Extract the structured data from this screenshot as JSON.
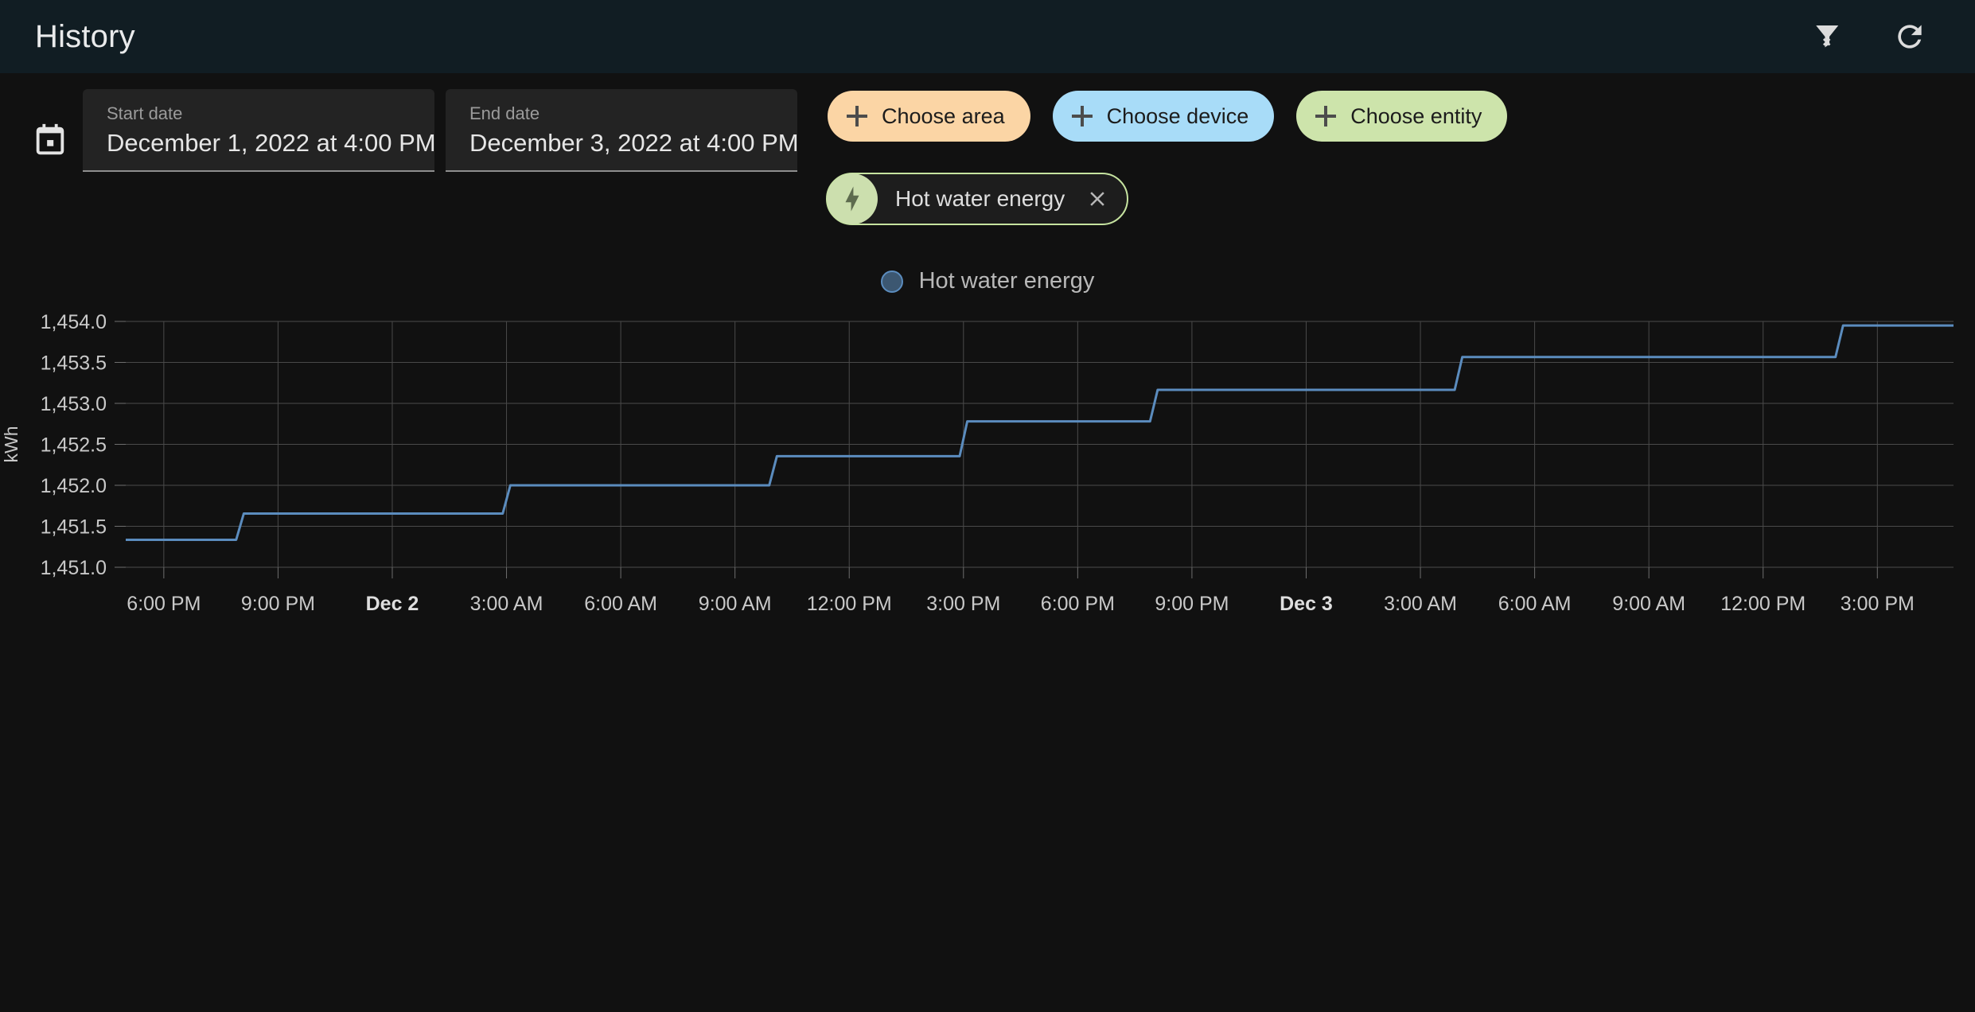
{
  "appbar": {
    "title": "History",
    "actions": [
      {
        "name": "filter-remove-icon",
        "label": "Clear filters"
      },
      {
        "name": "refresh-icon",
        "label": "Refresh"
      }
    ]
  },
  "filters": {
    "calendar_icon": "calendar-icon",
    "start_date": {
      "label": "Start date",
      "value": "December 1, 2022 at 4:00 PM"
    },
    "end_date": {
      "label": "End date",
      "value": "December 3, 2022 at 4:00 PM"
    },
    "choosers": [
      {
        "label": "Choose area",
        "color": "#fbd5a5",
        "icon": "plus-icon"
      },
      {
        "label": "Choose device",
        "color": "#a8dcf8",
        "icon": "plus-icon"
      },
      {
        "label": "Choose entity",
        "color": "#cde4ab",
        "icon": "plus-icon"
      }
    ],
    "selected_entities": [
      {
        "name": "Hot water energy",
        "icon": "lightning-bolt-icon",
        "avatar_color": "#ccdfae",
        "border_color": "#c6e3a0",
        "remove_label": "×"
      }
    ]
  },
  "legend": {
    "items": [
      {
        "label": "Hot water energy",
        "color": "#5b8cbe",
        "fill": "#3c5771"
      }
    ]
  },
  "chart_data": {
    "type": "line",
    "title": "",
    "xlabel": "",
    "ylabel": "kWh",
    "ylim": [
      1451.0,
      1454.0
    ],
    "ytick_labels": [
      "1,454.0",
      "1,453.5",
      "1,453.0",
      "1,452.5",
      "1,452.0",
      "1,451.5",
      "1,451.0"
    ],
    "ytick_values": [
      1454.0,
      1453.5,
      1453.0,
      1452.5,
      1452.0,
      1451.5,
      1451.0
    ],
    "xtick_labels": [
      "6:00 PM",
      "9:00 PM",
      "Dec 2",
      "3:00 AM",
      "6:00 AM",
      "9:00 AM",
      "12:00 PM",
      "3:00 PM",
      "6:00 PM",
      "9:00 PM",
      "Dec 3",
      "3:00 AM",
      "6:00 AM",
      "9:00 AM",
      "12:00 PM",
      "3:00 PM"
    ],
    "xtick_bold": [
      "Dec 2",
      "Dec 3"
    ],
    "grid": true,
    "legend_position": "top",
    "series": [
      {
        "name": "Hot water energy",
        "color": "#5b8cbe",
        "step": "post",
        "x_hours": [
          0,
          2.9,
          3.1,
          9.9,
          10.1,
          16.9,
          17.1,
          21.9,
          22.1,
          26.9,
          27.1,
          34.9,
          35.1,
          44.9,
          45.1,
          48
        ],
        "values": [
          1451.335,
          1451.335,
          1451.655,
          1451.655,
          1452.0,
          1452.0,
          1452.355,
          1452.355,
          1452.78,
          1452.78,
          1453.165,
          1453.165,
          1453.565,
          1453.565,
          1453.95,
          1453.95
        ]
      }
    ]
  }
}
